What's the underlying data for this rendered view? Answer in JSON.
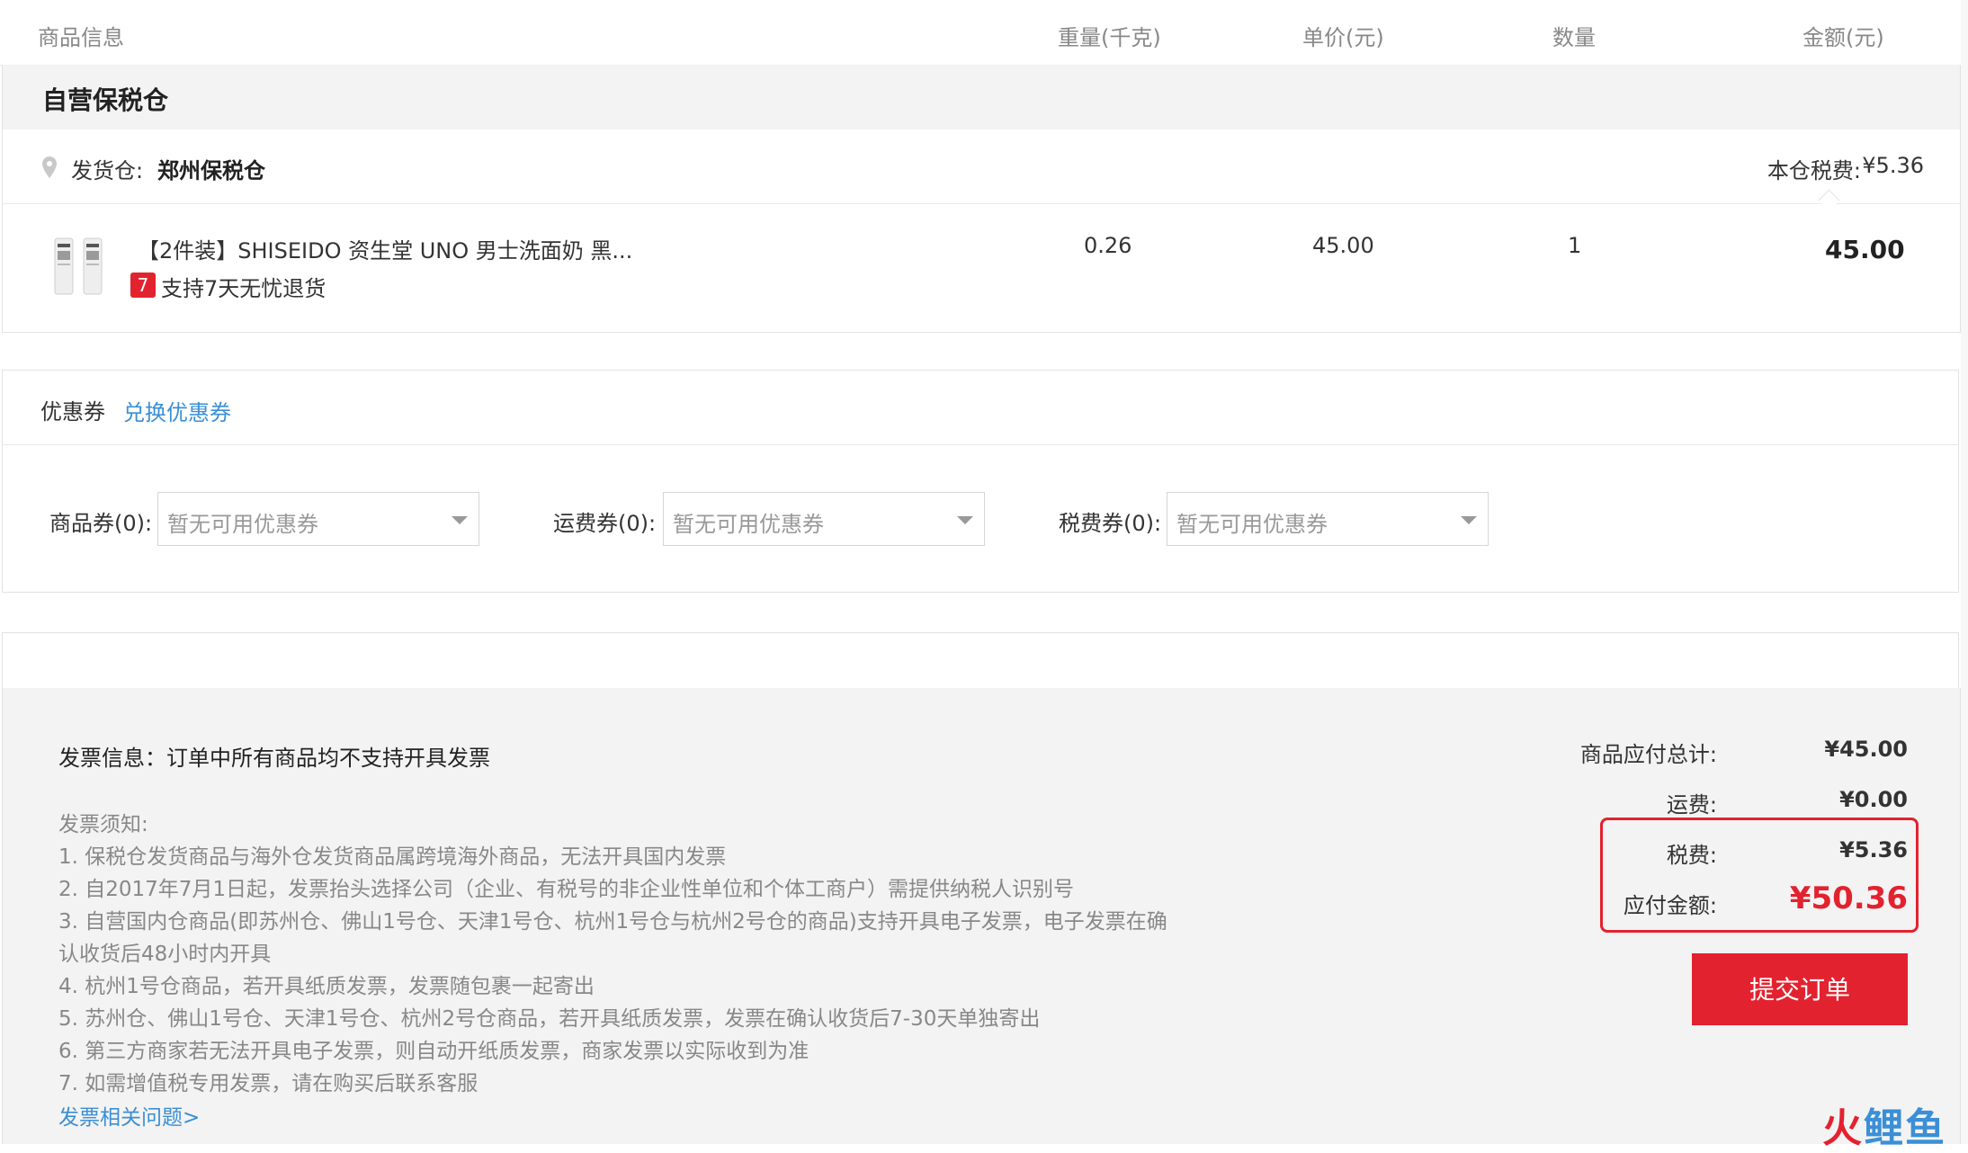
{
  "table_header": {
    "product_info": "商品信息",
    "weight": "重量(千克)",
    "unit_price": "单价(元)",
    "quantity": "数量",
    "amount": "金额(元)"
  },
  "warehouse": {
    "title": "自营保税仓",
    "ship_from_label": "发货仓:",
    "ship_from_value": "郑州保税仓",
    "tax_label": "本仓税费:",
    "tax_value": "¥5.36"
  },
  "product": {
    "name": "【2件装】SHISEIDO 资生堂 UNO 男士洗面奶 黑...",
    "badge": "7",
    "return_policy": "支持7天无忧退货",
    "weight": "0.26",
    "unit_price": "45.00",
    "quantity": "1",
    "amount": "45.00"
  },
  "coupon": {
    "title": "优惠券",
    "redeem_link": "兑换优惠券",
    "selects": [
      {
        "label": "商品券(0):",
        "value": "暂无可用优惠券"
      },
      {
        "label": "运费券(0):",
        "value": "暂无可用优惠券"
      },
      {
        "label": "税费券(0):",
        "value": "暂无可用优惠券"
      }
    ]
  },
  "invoice": {
    "info": "发票信息：订单中所有商品均不支持开具发票",
    "notice_title": "发票须知:",
    "notices": [
      "1. 保税仓发货商品与海外仓发货商品属跨境海外商品，无法开具国内发票",
      "2. 自2017年7月1日起，发票抬头选择公司（企业、有税号的非企业性单位和个体工商户）需提供纳税人识别号",
      "3. 自营国内仓商品(即苏州仓、佛山1号仓、天津1号仓、杭州1号仓与杭州2号仓的商品)支持开具电子发票，电子发票在确",
      "认收货后48小时内开具",
      "4. 杭州1号仓商品，若开具纸质发票，发票随包裹一起寄出",
      "5. 苏州仓、佛山1号仓、天津1号仓、杭州2号仓商品，若开具纸质发票，发票在确认收货后7-30天单独寄出",
      "6. 第三方商家若无法开具电子发票，则自动开纸质发票，商家发票以实际收到为准",
      "7. 如需增值税专用发票，请在购买后联系客服"
    ],
    "faq_link": "发票相关问题>"
  },
  "summary": {
    "subtotal_label": "商品应付总计:",
    "subtotal_value": "¥45.00",
    "shipping_label": "运费:",
    "shipping_value": "¥0.00",
    "tax_label": "税费:",
    "tax_value": "¥5.36",
    "total_label": "应付金额:",
    "total_value": "¥50.36",
    "submit_label": "提交订单"
  },
  "watermark": {
    "part_a": "火",
    "part_b": "鲤鱼"
  },
  "colors": {
    "accent_red": "#e3222f",
    "link_blue": "#3b8fd6",
    "band_gray": "#f3f3f3"
  }
}
